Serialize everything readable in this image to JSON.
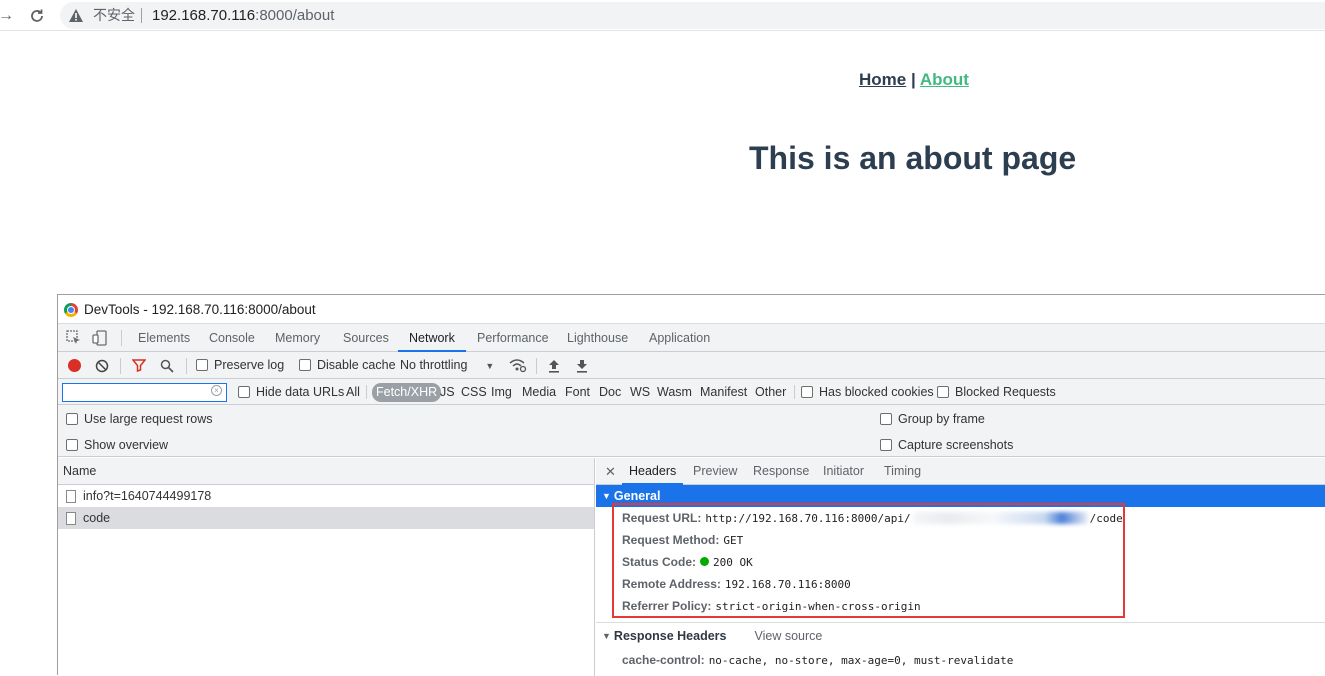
{
  "browser": {
    "back_icon": "arrow-left-icon",
    "reload_icon": "reload-icon",
    "security_label": "不安全",
    "url_host": "192.168.70.116",
    "url_path": ":8000/about"
  },
  "page": {
    "nav_home": "Home",
    "nav_sep": "|",
    "nav_about": "About",
    "title": "This is an about page",
    "colors": {
      "text": "#2c3e50",
      "link_active": "#42b983"
    }
  },
  "devtools": {
    "title": "DevTools - 192.168.70.116:8000/about",
    "tabs": [
      "Elements",
      "Console",
      "Memory",
      "Sources",
      "Network",
      "Performance",
      "Lighthouse",
      "Application"
    ],
    "active_tab": "Network",
    "toolbar": {
      "preserve_log": "Preserve log",
      "disable_cache": "Disable cache",
      "throttling": "No throttling"
    },
    "filter": {
      "input_value": "",
      "hide_data_urls": "Hide data URLs",
      "types": [
        "All",
        "Fetch/XHR",
        "JS",
        "CSS",
        "Img",
        "Media",
        "Font",
        "Doc",
        "WS",
        "Wasm",
        "Manifest",
        "Other"
      ],
      "selected_type": "Fetch/XHR",
      "has_blocked_cookies": "Has blocked cookies",
      "blocked_requests": "Blocked Requests"
    },
    "settings": {
      "large_rows": "Use large request rows",
      "show_overview": "Show overview",
      "group_by_frame": "Group by frame",
      "capture_screenshots": "Capture screenshots"
    },
    "requests": {
      "header": "Name",
      "items": [
        "info?t=1640744499178",
        "code"
      ],
      "selected": "code"
    },
    "details": {
      "tabs": [
        "Headers",
        "Preview",
        "Response",
        "Initiator",
        "Timing"
      ],
      "active_tab": "Headers",
      "general_title": "General",
      "request_url_label": "Request URL:",
      "request_url_start": "http://192.168.70.116:8000/api/",
      "request_url_end": "/code",
      "request_method_label": "Request Method:",
      "request_method": "GET",
      "status_code_label": "Status Code:",
      "status_code": "200 OK",
      "remote_address_label": "Remote Address:",
      "remote_address": "192.168.70.116:8000",
      "referrer_policy_label": "Referrer Policy:",
      "referrer_policy": "strict-origin-when-cross-origin",
      "response_headers_title": "Response Headers",
      "view_source": "View source",
      "cache_control_label": "cache-control:",
      "cache_control": "no-cache, no-store, max-age=0, must-revalidate"
    },
    "colors": {
      "accent": "#1a73e8",
      "record": "#d93025",
      "highlight_box": "#e53935",
      "status_ok": "#00aa00"
    }
  }
}
